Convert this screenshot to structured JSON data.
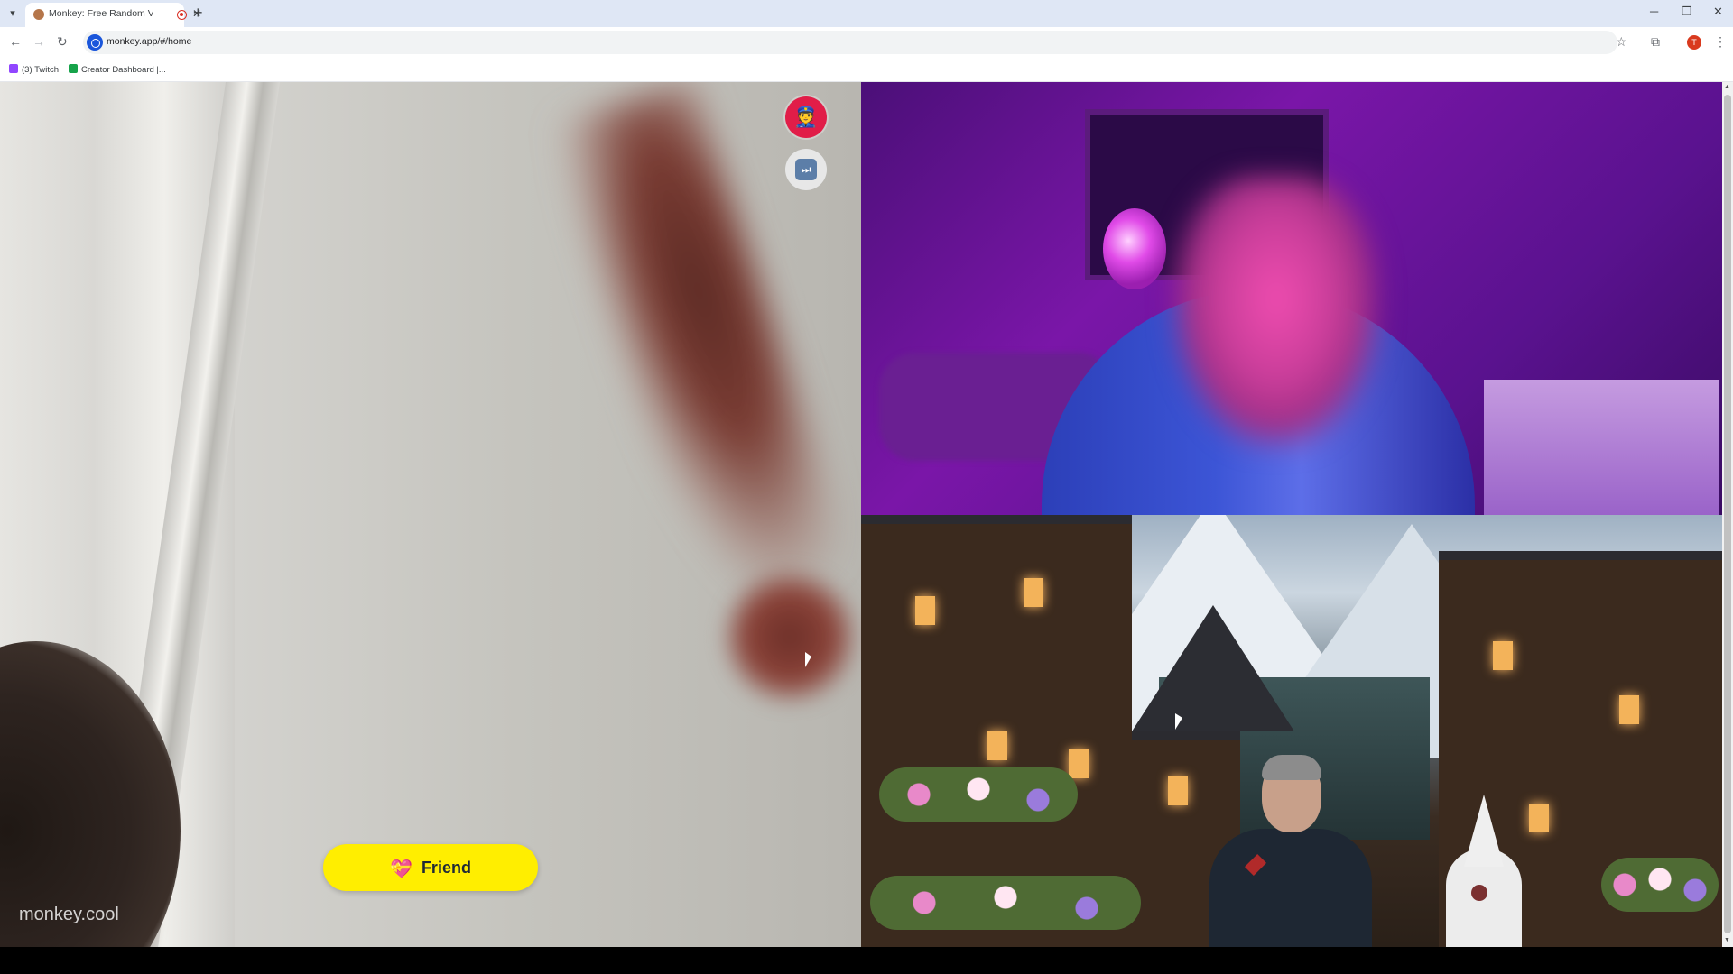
{
  "browser": {
    "tab_title": "Monkey: Free Random Vide",
    "tab_close": "✕",
    "new_tab": "+",
    "url": "monkey.app/#/home",
    "profile_initial": "T",
    "bookmarks": [
      {
        "label": "(3) Twitch",
        "icon_color": "#9146ff"
      },
      {
        "label": "Creator Dashboard |...",
        "icon_color": "#16a34a"
      }
    ],
    "window_controls": {
      "minimize": "─",
      "restore": "❐",
      "close": "✕"
    }
  },
  "app": {
    "friend_button": {
      "icon": "💝",
      "label": "Friend"
    },
    "watermark": "monkey.cool",
    "report_button_icon": "👮",
    "skip_button_icon": "⏭"
  },
  "colors": {
    "friend_button_bg": "#ffee00",
    "report_button_bg": "#e11d48",
    "remote_video_tint": "#7a16a8"
  }
}
